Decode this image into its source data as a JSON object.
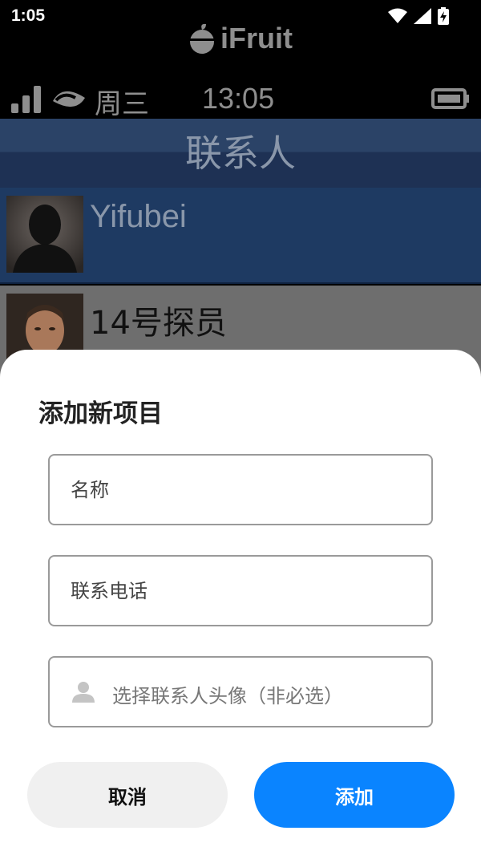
{
  "system_status": {
    "time": "1:05"
  },
  "phone_app": {
    "brand": "iFruit",
    "status": {
      "day": "周三",
      "clock": "13:05"
    },
    "contacts_title": "联系人",
    "contacts": [
      {
        "name": "Yifubei",
        "selected": true
      },
      {
        "name": "14号探员",
        "selected": false
      }
    ]
  },
  "sheet": {
    "title": "添加新项目",
    "name_field": {
      "placeholder": "名称",
      "value": ""
    },
    "phone_field": {
      "placeholder": "联系电话",
      "value": ""
    },
    "avatar_field": {
      "label": "选择联系人头像（非必选）",
      "icon": "person-icon"
    },
    "cancel_label": "取消",
    "add_label": "添加"
  },
  "colors": {
    "accent": "#0a84ff",
    "selected_row": "#1e3a62",
    "header_band": "#2b4367"
  }
}
